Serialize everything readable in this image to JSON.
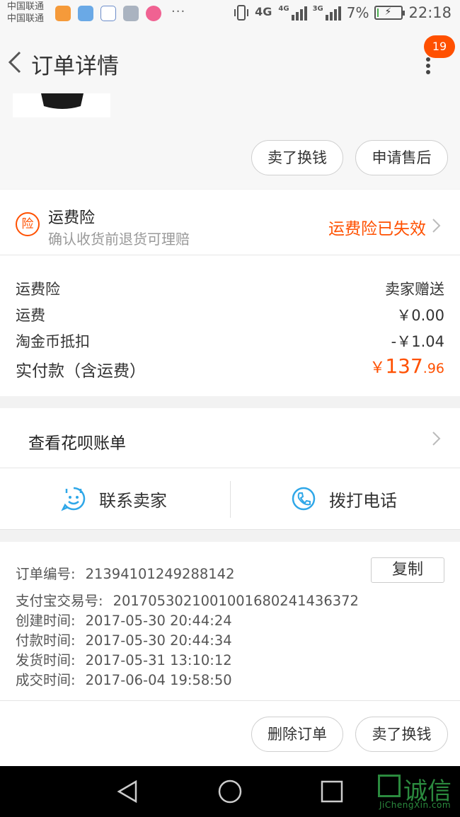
{
  "status_bar": {
    "carrier_1": "中国联通",
    "carrier_2": "中国联通",
    "dots": "···",
    "net_1": "4G",
    "net_2": "4G",
    "net_3": "3G",
    "battery_percent": "7%",
    "battery_level": 0.07,
    "time": "22:18"
  },
  "nav": {
    "title": "订单详情",
    "badge_count": "19"
  },
  "product_actions": {
    "sell_label": "卖了换钱",
    "after_sale_label": "申请售后"
  },
  "insurance": {
    "icon_text": "险",
    "title": "运费险",
    "subtitle": "确认收货前退货可理赔",
    "status": "运费险已失效"
  },
  "fees": {
    "rows": [
      {
        "label": "运费险",
        "value": "卖家赠送"
      },
      {
        "label": "运费",
        "value": "￥0.00"
      },
      {
        "label": "淘金币抵扣",
        "value": "-￥1.04"
      }
    ],
    "paid_label": "实付款（含运费）",
    "paid_currency": "￥",
    "paid_integer": "137",
    "paid_decimal": ".96"
  },
  "huabei": {
    "label": "查看花呗账单"
  },
  "contact": {
    "seller_label": "联系卖家",
    "phone_label": "拨打电话"
  },
  "order_info": {
    "order_no_label": "订单编号:",
    "order_no": "21394101249288142",
    "copy_label": "复制",
    "alipay_label": "支付宝交易号:",
    "alipay_no": "2017053021001001680241436372",
    "created_label": "创建时间:",
    "created": "2017-05-30 20:44:24",
    "paid_label": "付款时间:",
    "paid": "2017-05-30 20:44:34",
    "shipped_label": "发货时间:",
    "shipped": "2017-05-31 13:10:12",
    "done_label": "成交时间:",
    "done": "2017-06-04 19:58:50"
  },
  "bottom_actions": {
    "delete_label": "删除订单",
    "sell_label": "卖了换钱"
  },
  "watermark": {
    "text": "诚信",
    "sub": "JiChengXin.com"
  },
  "colors": {
    "accent": "#ff5000",
    "icon_blue": "#2fa7e8"
  }
}
